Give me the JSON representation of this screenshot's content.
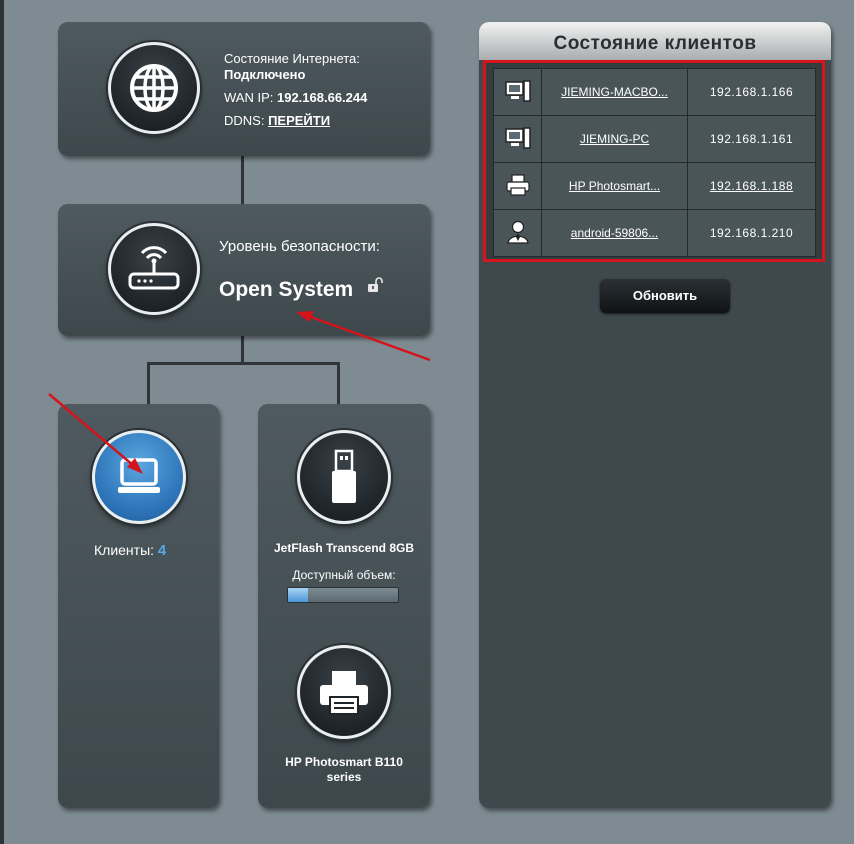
{
  "internet": {
    "status_label": "Состояние Интернета:",
    "status_value": "Подключено",
    "wan_label": "WAN IP:",
    "wan_value": "192.168.66.244",
    "ddns_label": "DDNS:",
    "ddns_link": "ПЕРЕЙТИ"
  },
  "security": {
    "label": "Уровень безопасности:",
    "value": "Open System"
  },
  "clients_card": {
    "label": "Клиенты:",
    "count": "4"
  },
  "usb": {
    "device_name": "JetFlash Transcend 8GB",
    "capacity_label": "Доступный объем:",
    "used_fraction": 0.18
  },
  "printer": {
    "name_line1": "HP Photosmart B110",
    "name_line2": "series"
  },
  "client_status": {
    "title": "Состояние клиентов",
    "refresh_label": "Обновить",
    "rows": [
      {
        "icon": "computer-icon",
        "name": "JIEMING-MACBO...",
        "ip": "192.168.1.166",
        "ip_link": false
      },
      {
        "icon": "computer-icon",
        "name": "JIEMING-PC",
        "ip": "192.168.1.161",
        "ip_link": false
      },
      {
        "icon": "printer-icon",
        "name": "HP Photosmart...",
        "ip": "192.168.1.188",
        "ip_link": true
      },
      {
        "icon": "user-icon",
        "name": "android-59806...",
        "ip": "192.168.1.210",
        "ip_link": false
      }
    ]
  },
  "colors": {
    "highlight_border": "#d6141c",
    "arrow": "#d4141c",
    "accent_blue": "#4c97d6"
  }
}
